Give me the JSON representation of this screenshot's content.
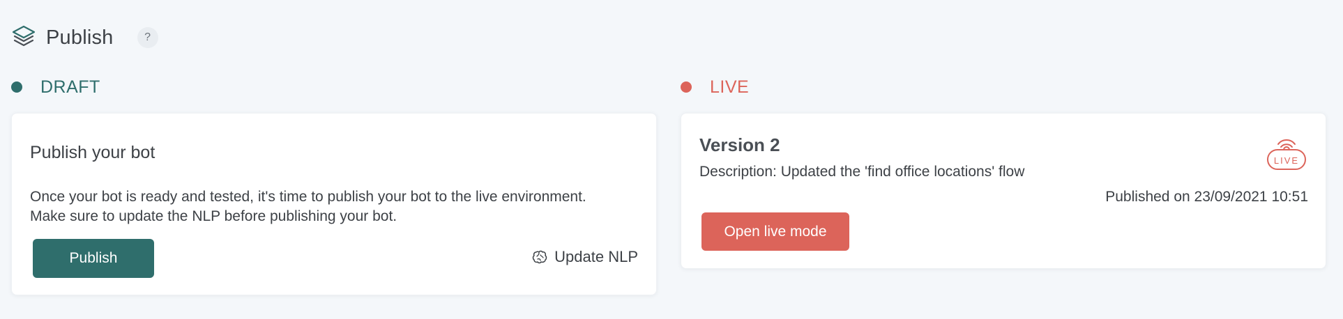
{
  "header": {
    "title": "Publish",
    "help_label": "?"
  },
  "draft": {
    "status_label": "DRAFT",
    "status_color": "#2f6e6c",
    "card_title": "Publish your bot",
    "card_description": "Once your bot is ready and tested, it's time to publish your bot to the live environment. Make sure to update the NLP before publishing your bot.",
    "publish_button": "Publish",
    "update_nlp_label": "Update NLP",
    "update_nlp_icon": "brain-icon"
  },
  "live": {
    "status_label": "LIVE",
    "status_color": "#dc645a",
    "version": "Version 2",
    "description": "Description: Updated the 'find office locations' flow",
    "published_on": "Published on 23/09/2021 10:51",
    "open_live_button": "Open live mode",
    "badge_text": "LIVE",
    "badge_icon": "live-broadcast-icon"
  }
}
